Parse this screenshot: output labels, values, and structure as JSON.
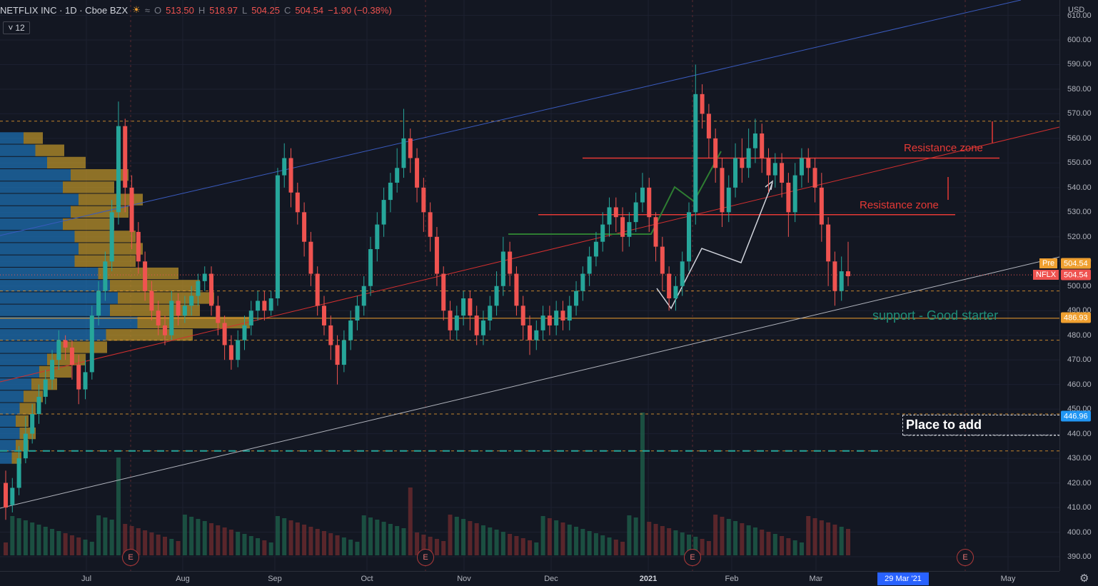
{
  "header": {
    "symbol": "NETFLIX INC · 1D · Cboe BZX",
    "open_label": "O",
    "open": "513.50",
    "high_label": "H",
    "high": "518.97",
    "low_label": "L",
    "low": "504.25",
    "close_label": "C",
    "close": "504.54",
    "change": "−1.90 (−0.38%)",
    "weather_icon": "sun-cloud-icon",
    "compare_icon": "wave-icon"
  },
  "interval": {
    "value": "12",
    "chevron": "˅"
  },
  "currency": "USD",
  "price_axis": {
    "ticks": [
      "610.00",
      "600.00",
      "590.00",
      "580.00",
      "570.00",
      "560.00",
      "550.00",
      "540.00",
      "530.00",
      "520.00",
      "510.00",
      "500.00",
      "490.00",
      "480.00",
      "470.00",
      "460.00",
      "450.00",
      "440.00",
      "430.00",
      "420.00",
      "410.00",
      "400.00",
      "390.00"
    ]
  },
  "time_axis": {
    "ticks": [
      "Jul",
      "Aug",
      "Sep",
      "Oct",
      "Nov",
      "Dec",
      "2021",
      "Feb",
      "Mar",
      "May"
    ],
    "selected_date": "29 Mar '21"
  },
  "tags": {
    "pre_label": "Pre",
    "pre_value": "504.54",
    "sym_label": "NFLX",
    "sym_value": "504.54",
    "support_value": "486.93",
    "add_value": "446.96"
  },
  "annotations": {
    "resistance_upper": "Resistance zone",
    "resistance_lower": "Resistance zone",
    "support": "support - Good starter",
    "place_to_add": "Place to add"
  },
  "earnings_label": "E",
  "colors": {
    "background": "#131722",
    "up": "#26a69a",
    "down": "#ef5350",
    "resistance": "#e53935",
    "support_text": "#1e8f7a",
    "add_tag": "#2196f3",
    "support_tag": "#f0a030"
  },
  "chart_data": {
    "type": "candlestick",
    "title": "NETFLIX INC · 1D · Cboe BZX",
    "ylim": [
      385,
      615
    ],
    "levels": {
      "resistance_upper": 552,
      "resistance_lower": 529,
      "support": 486.93,
      "add": 446.96,
      "dashed_orange": [
        567,
        498,
        478,
        448,
        433
      ]
    },
    "candles": [
      [
        420,
        410,
        425,
        405
      ],
      [
        411,
        418,
        422,
        408
      ],
      [
        418,
        430,
        435,
        415
      ],
      [
        430,
        440,
        447,
        428
      ],
      [
        440,
        448,
        452,
        436
      ],
      [
        448,
        455,
        460,
        444
      ],
      [
        455,
        462,
        466,
        452
      ],
      [
        462,
        470,
        474,
        458
      ],
      [
        470,
        478,
        482,
        466
      ],
      [
        478,
        475,
        480,
        470
      ],
      [
        475,
        468,
        478,
        462
      ],
      [
        468,
        458,
        472,
        452
      ],
      [
        458,
        465,
        470,
        454
      ],
      [
        465,
        488,
        492,
        462
      ],
      [
        488,
        498,
        502,
        484
      ],
      [
        498,
        510,
        514,
        494
      ],
      [
        510,
        530,
        535,
        506
      ],
      [
        530,
        565,
        575,
        525
      ],
      [
        565,
        540,
        568,
        530
      ],
      [
        540,
        522,
        545,
        515
      ],
      [
        522,
        510,
        526,
        505
      ],
      [
        510,
        498,
        514,
        494
      ],
      [
        498,
        490,
        502,
        486
      ],
      [
        490,
        484,
        494,
        480
      ],
      [
        484,
        480,
        488,
        476
      ],
      [
        480,
        494,
        498,
        478
      ],
      [
        494,
        488,
        497,
        484
      ],
      [
        488,
        492,
        496,
        485
      ],
      [
        492,
        496,
        500,
        488
      ],
      [
        496,
        502,
        505,
        492
      ],
      [
        502,
        505,
        508,
        498
      ],
      [
        505,
        492,
        508,
        488
      ],
      [
        492,
        485,
        496,
        480
      ],
      [
        485,
        476,
        488,
        470
      ],
      [
        476,
        470,
        480,
        466
      ],
      [
        470,
        478,
        482,
        467
      ],
      [
        478,
        484,
        488,
        474
      ],
      [
        484,
        490,
        494,
        480
      ],
      [
        490,
        494,
        498,
        486
      ],
      [
        494,
        490,
        498,
        486
      ],
      [
        490,
        495,
        498,
        488
      ],
      [
        495,
        545,
        548,
        492
      ],
      [
        545,
        552,
        558,
        540
      ],
      [
        552,
        538,
        556,
        532
      ],
      [
        538,
        530,
        542,
        525
      ],
      [
        530,
        518,
        534,
        512
      ],
      [
        518,
        505,
        522,
        500
      ],
      [
        505,
        492,
        508,
        488
      ],
      [
        492,
        484,
        496,
        480
      ],
      [
        484,
        476,
        488,
        470
      ],
      [
        476,
        468,
        480,
        460
      ],
      [
        468,
        478,
        482,
        465
      ],
      [
        478,
        486,
        490,
        474
      ],
      [
        486,
        492,
        496,
        482
      ],
      [
        492,
        500,
        504,
        488
      ],
      [
        500,
        515,
        520,
        496
      ],
      [
        515,
        525,
        530,
        510
      ],
      [
        525,
        535,
        540,
        520
      ],
      [
        535,
        542,
        546,
        530
      ],
      [
        542,
        548,
        556,
        538
      ],
      [
        548,
        560,
        572,
        544
      ],
      [
        560,
        552,
        564,
        546
      ],
      [
        552,
        540,
        556,
        534
      ],
      [
        540,
        530,
        544,
        522
      ],
      [
        530,
        520,
        534,
        514
      ],
      [
        520,
        505,
        524,
        500
      ],
      [
        505,
        490,
        508,
        486
      ],
      [
        490,
        482,
        494,
        478
      ],
      [
        482,
        488,
        492,
        478
      ],
      [
        488,
        495,
        498,
        484
      ],
      [
        495,
        488,
        498,
        482
      ],
      [
        488,
        480,
        492,
        476
      ],
      [
        480,
        486,
        490,
        476
      ],
      [
        486,
        492,
        496,
        482
      ],
      [
        492,
        500,
        506,
        488
      ],
      [
        500,
        514,
        520,
        496
      ],
      [
        514,
        505,
        518,
        500
      ],
      [
        505,
        492,
        508,
        488
      ],
      [
        492,
        484,
        496,
        478
      ],
      [
        484,
        478,
        488,
        472
      ],
      [
        478,
        482,
        486,
        474
      ],
      [
        482,
        488,
        492,
        478
      ],
      [
        488,
        484,
        492,
        480
      ],
      [
        484,
        490,
        494,
        480
      ],
      [
        490,
        486,
        494,
        482
      ],
      [
        486,
        492,
        496,
        482
      ],
      [
        492,
        498,
        502,
        488
      ],
      [
        498,
        505,
        508,
        494
      ],
      [
        505,
        512,
        516,
        500
      ],
      [
        512,
        518,
        522,
        508
      ],
      [
        518,
        525,
        530,
        514
      ],
      [
        525,
        532,
        536,
        520
      ],
      [
        532,
        528,
        536,
        522
      ],
      [
        528,
        520,
        532,
        514
      ],
      [
        520,
        526,
        530,
        516
      ],
      [
        526,
        534,
        538,
        522
      ],
      [
        534,
        540,
        546,
        530
      ],
      [
        540,
        528,
        544,
        522
      ],
      [
        528,
        516,
        530,
        510
      ],
      [
        516,
        505,
        520,
        498
      ],
      [
        505,
        495,
        508,
        490
      ],
      [
        495,
        500,
        504,
        490
      ],
      [
        500,
        510,
        514,
        496
      ],
      [
        510,
        530,
        534,
        506
      ],
      [
        530,
        578,
        590,
        525
      ],
      [
        578,
        570,
        582,
        564
      ],
      [
        570,
        560,
        574,
        552
      ],
      [
        560,
        548,
        564,
        542
      ],
      [
        548,
        530,
        552,
        524
      ],
      [
        530,
        540,
        545,
        526
      ],
      [
        540,
        552,
        558,
        536
      ],
      [
        552,
        548,
        560,
        542
      ],
      [
        548,
        556,
        564,
        544
      ],
      [
        556,
        562,
        568,
        550
      ],
      [
        562,
        552,
        566,
        546
      ],
      [
        552,
        545,
        556,
        538
      ],
      [
        545,
        550,
        554,
        540
      ],
      [
        550,
        542,
        554,
        536
      ],
      [
        542,
        530,
        546,
        520
      ],
      [
        530,
        545,
        550,
        526
      ],
      [
        545,
        552,
        556,
        540
      ],
      [
        552,
        548,
        556,
        542
      ],
      [
        548,
        540,
        552,
        534
      ],
      [
        540,
        525,
        546,
        518
      ],
      [
        525,
        510,
        528,
        500
      ],
      [
        510,
        498,
        514,
        492
      ],
      [
        498,
        506,
        512,
        494
      ],
      [
        506,
        504,
        518,
        500
      ]
    ]
  }
}
